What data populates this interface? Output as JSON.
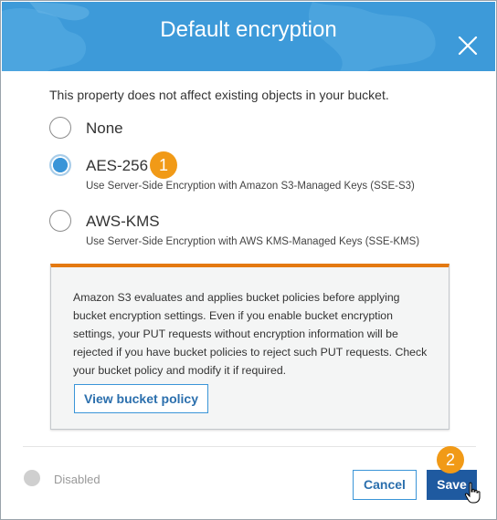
{
  "dialog": {
    "title": "Default encryption",
    "close_icon": "close-icon"
  },
  "intro_text": "This property does not affect existing objects in your bucket.",
  "options": [
    {
      "label": "None",
      "description": "",
      "selected": false
    },
    {
      "label": "AES-256",
      "description": "Use Server-Side Encryption with Amazon S3-Managed Keys (SSE-S3)",
      "selected": true
    },
    {
      "label": "AWS-KMS",
      "description": "Use Server-Side Encryption with AWS KMS-Managed Keys (SSE-KMS)",
      "selected": false
    }
  ],
  "info_box": {
    "text": "Amazon S3 evaluates and applies bucket policies before applying bucket encryption settings. Even if you enable bucket encryption settings, your PUT requests without encryption information will be rejected if you have bucket policies to reject such PUT requests. Check your bucket policy and modify it if required.",
    "button_label": "View bucket policy"
  },
  "footer": {
    "status_label": "Disabled",
    "cancel_label": "Cancel",
    "save_label": "Save"
  },
  "annotations": {
    "step1": "1",
    "step2": "2"
  },
  "colors": {
    "header": "#3d9ad9",
    "accent_orange": "#f19a17",
    "primary_button": "#1f5aa0",
    "info_border": "#e47911"
  }
}
